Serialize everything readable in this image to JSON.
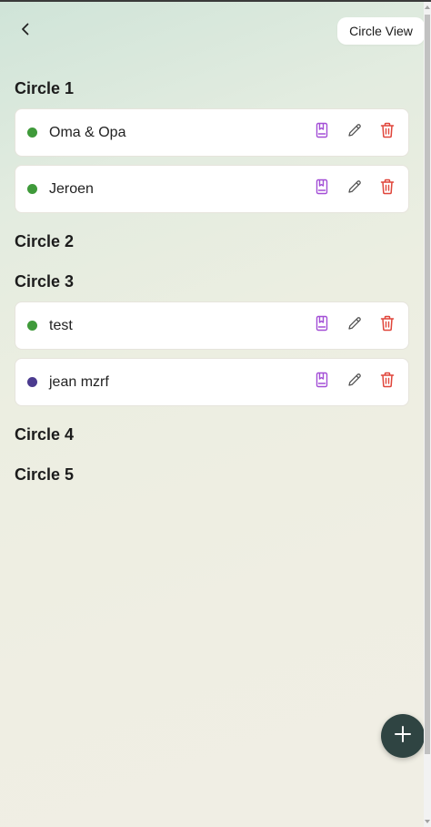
{
  "header": {
    "view_button_label": "Circle View"
  },
  "circles": [
    {
      "title": "Circle 1",
      "people": [
        {
          "name": "Oma & Opa",
          "dot_color": "#3f9a3a"
        },
        {
          "name": "Jeroen",
          "dot_color": "#3f9a3a"
        }
      ]
    },
    {
      "title": "Circle 2",
      "people": []
    },
    {
      "title": "Circle 3",
      "people": [
        {
          "name": "test",
          "dot_color": "#3f9a3a"
        },
        {
          "name": "jean mzrf",
          "dot_color": "#4b3b8f"
        }
      ]
    },
    {
      "title": "Circle 4",
      "people": []
    },
    {
      "title": "Circle 5",
      "people": []
    }
  ],
  "colors": {
    "journal_icon": "#a34fd6",
    "edit_icon": "#555555",
    "delete_icon": "#e0453a",
    "fab_bg": "#2f4442"
  },
  "icons": {
    "back": "chevron-left-icon",
    "journal": "journal-icon",
    "edit": "pencil-icon",
    "delete": "trash-icon",
    "add": "plus-icon"
  }
}
